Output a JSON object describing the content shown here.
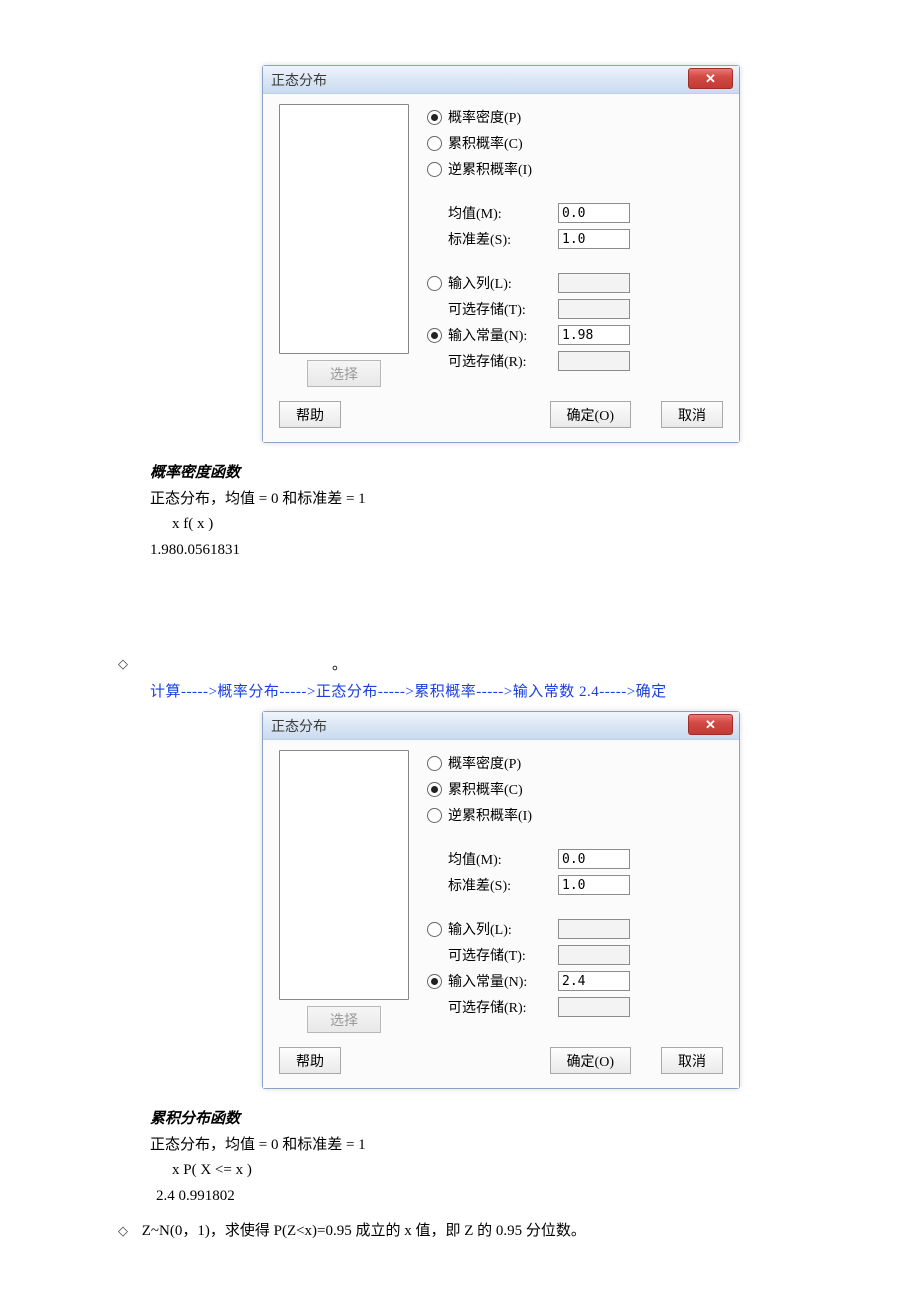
{
  "dialog1": {
    "title": "正态分布",
    "radio_prob_density": "概率密度(P)",
    "radio_cumulative": "累积概率(C)",
    "radio_inverse": "逆累积概率(I)",
    "selected": "prob_density",
    "mean_label": "均值(M):",
    "mean_value": "0.0",
    "std_label": "标准差(S):",
    "std_value": "1.0",
    "input_col_label": "输入列(L):",
    "input_col_value": "",
    "store_t_label": "可选存储(T):",
    "store_t_value": "",
    "input_const_label": "输入常量(N):",
    "input_const_value": "1.98",
    "store_r_label": "可选存储(R):",
    "store_r_value": "",
    "input_selected": "const",
    "select_btn": "选择",
    "help_btn": "帮助",
    "ok_btn": "确定(O)",
    "cancel_btn": "取消"
  },
  "output1": {
    "title": "概率密度函数",
    "line1": "正态分布，均值 = 0 和标准差 = 1",
    "header": "x        f( x )",
    "row": "1.980.0561831"
  },
  "path1": {
    "text": "计算----->概率分布----->正态分布----->累积概率----->输入常数 2.4----->确定"
  },
  "dialog2": {
    "title": "正态分布",
    "radio_prob_density": "概率密度(P)",
    "radio_cumulative": "累积概率(C)",
    "radio_inverse": "逆累积概率(I)",
    "selected": "cumulative",
    "mean_label": "均值(M):",
    "mean_value": "0.0",
    "std_label": "标准差(S):",
    "std_value": "1.0",
    "input_col_label": "输入列(L):",
    "input_col_value": "",
    "store_t_label": "可选存储(T):",
    "store_t_value": "",
    "input_const_label": "输入常量(N):",
    "input_const_value": "2.4",
    "store_r_label": "可选存储(R):",
    "store_r_value": "",
    "input_selected": "const",
    "select_btn": "选择",
    "help_btn": "帮助",
    "ok_btn": "确定(O)",
    "cancel_btn": "取消"
  },
  "output2": {
    "title": "累积分布函数",
    "line1": "正态分布，均值 = 0 和标准差 = 1",
    "header": "x    P( X <= x )",
    "row": "2.4        0.991802"
  },
  "note": {
    "text": "Z~N(0，1)，求使得 P(Z<x)=0.95 成立的 x 值，即 Z 的 0.95 分位数。"
  }
}
